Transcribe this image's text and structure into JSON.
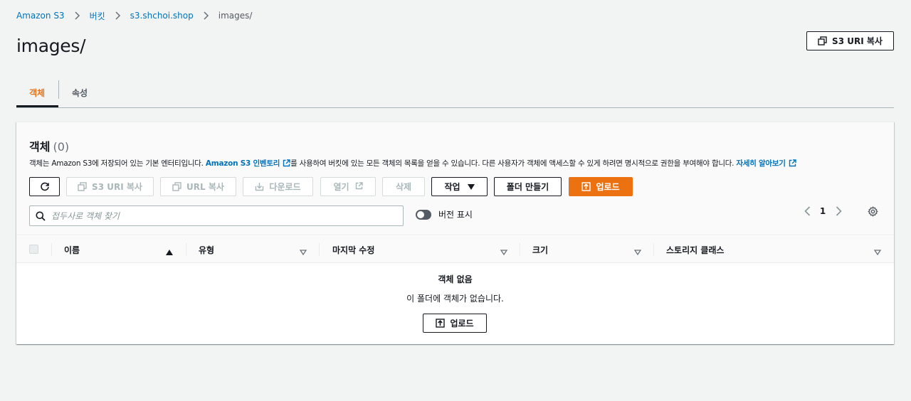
{
  "breadcrumb": {
    "items": [
      "Amazon S3",
      "버킷",
      "s3.shchoi.shop"
    ],
    "current": "images/"
  },
  "page": {
    "title": "images/",
    "copy_uri_label": "S3 URI 복사"
  },
  "tabs": {
    "objects": "객체",
    "properties": "속성"
  },
  "panel": {
    "title": "객체",
    "count": "(0)",
    "desc_part1": "객체는 Amazon S3에 저장되어 있는 기본 엔터티입니다. ",
    "desc_link1": "Amazon S3 인벤토리",
    "desc_part2": "를 사용하여 버킷에 있는 모든 객체의 목록을 얻을 수 있습니다. 다른 사용자가 객체에 액세스할 수 있게 하려면 명시적으로 권한을 부여해야 합니다. ",
    "desc_link2": "자세히 알아보기"
  },
  "actions": {
    "copy_s3_uri": "S3 URI 복사",
    "copy_url": "URL 복사",
    "download": "다운로드",
    "open": "열기",
    "delete": "삭제",
    "actions": "작업",
    "create_folder": "폴더 만들기",
    "upload": "업로드"
  },
  "search": {
    "placeholder": "접두사로 객체 찾기"
  },
  "versions_toggle": "버전 표시",
  "pagination": {
    "page": "1"
  },
  "table": {
    "columns": [
      "이름",
      "유형",
      "마지막 수정",
      "크기",
      "스토리지 클래스"
    ]
  },
  "empty": {
    "title": "객체 없음",
    "description": "이 폴더에 객체가 없습니다.",
    "upload": "업로드"
  },
  "colors": {
    "primary": "#ec7211",
    "link": "#0073bb",
    "text": "#16191f",
    "background": "#f2f3f3"
  }
}
